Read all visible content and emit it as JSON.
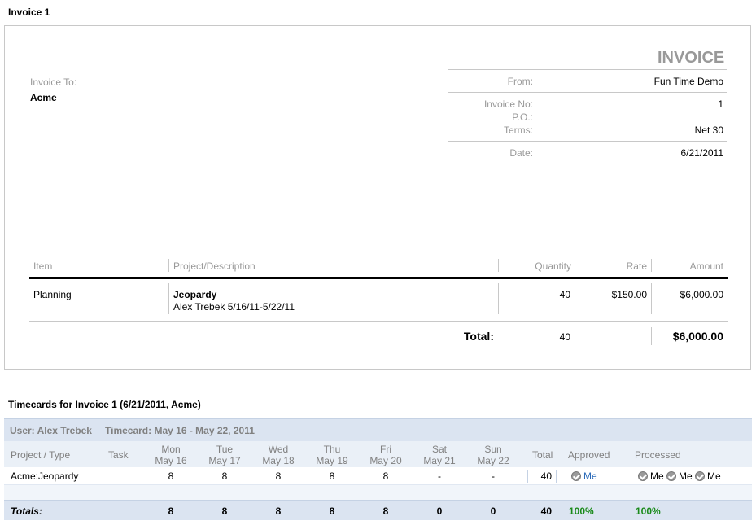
{
  "page_title": "Invoice 1",
  "invoice": {
    "heading": "INVOICE",
    "invoice_to_label": "Invoice To:",
    "invoice_to_value": "Acme",
    "from_label": "From:",
    "from_value": "Fun Time Demo",
    "invoice_no_label": "Invoice No:",
    "invoice_no_value": "1",
    "po_label": "P.O.:",
    "po_value": "",
    "terms_label": "Terms:",
    "terms_value": "Net 30",
    "date_label": "Date:",
    "date_value": "6/21/2011",
    "columns": {
      "item": "Item",
      "project": "Project/Description",
      "quantity": "Quantity",
      "rate": "Rate",
      "amount": "Amount"
    },
    "line": {
      "item": "Planning",
      "project": "Jeopardy",
      "description": "Alex Trebek 5/16/11-5/22/11",
      "quantity": "40",
      "rate": "$150.00",
      "amount": "$6,000.00"
    },
    "total_label": "Total:",
    "total_quantity": "40",
    "total_amount": "$6,000.00"
  },
  "timecards": {
    "title": "Timecards for Invoice 1 (6/21/2011, Acme)",
    "user_label": "User: Alex Trebek",
    "timecard_label": "Timecard: May 16 - May 22, 2011",
    "headers": {
      "project": "Project / Type",
      "task": "Task",
      "days": [
        {
          "day": "Mon",
          "date": "May 16"
        },
        {
          "day": "Tue",
          "date": "May 17"
        },
        {
          "day": "Wed",
          "date": "May 18"
        },
        {
          "day": "Thu",
          "date": "May 19"
        },
        {
          "day": "Fri",
          "date": "May 20"
        },
        {
          "day": "Sat",
          "date": "May 21"
        },
        {
          "day": "Sun",
          "date": "May 22"
        }
      ],
      "total": "Total",
      "approved": "Approved",
      "processed": "Processed"
    },
    "row": {
      "project": "Acme:Jeopardy",
      "task": "",
      "hours": [
        "8",
        "8",
        "8",
        "8",
        "8",
        "-",
        "-"
      ],
      "total": "40",
      "approved_by": "Me",
      "processed_by": [
        "Me",
        "Me",
        "Me"
      ]
    },
    "totals": {
      "label": "Totals:",
      "hours": [
        "8",
        "8",
        "8",
        "8",
        "8",
        "0",
        "0"
      ],
      "total": "40",
      "approved": "100%",
      "processed": "100%"
    },
    "colors": {
      "header_bg": "#dbe4f1",
      "subheader_bg": "#eaf0f7",
      "row_bg": "#ffffff",
      "alt_row_bg": "#f1f5fa",
      "totals_bg": "#dbe4f1",
      "percent_green": "#1a8a1a"
    }
  }
}
